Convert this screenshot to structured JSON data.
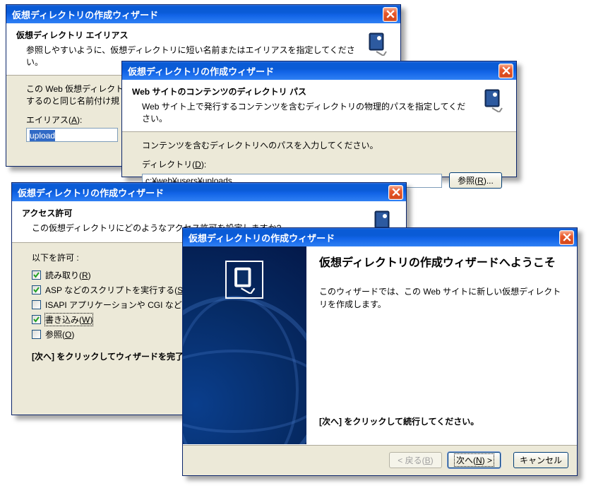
{
  "dialog1": {
    "title": "仮想ディレクトリの作成ウィザード",
    "band_title": "仮想ディレクトリ エイリアス",
    "band_desc": "参照しやすいように、仮想ディレクトリに短い名前またはエイリアスを指定してください。",
    "body_intro_line1": "この Web 仮想ディレクト",
    "body_intro_line2": "するのと同じ名前付け規",
    "alias_label_pre": "エイリアス(",
    "alias_key": "A",
    "alias_label_post": "):",
    "alias_value": "upload"
  },
  "dialog2": {
    "title": "仮想ディレクトリの作成ウィザード",
    "band_title": "Web サイトのコンテンツのディレクトリ パス",
    "band_desc": "Web サイト上で発行するコンテンツを含むディレクトリの物理的パスを指定してください。",
    "prompt": "コンテンツを含むディレクトリへのパスを入力してください。",
    "dir_label_pre": "ディレクトリ(",
    "dir_key": "D",
    "dir_label_post": "):",
    "dir_value": "c:¥web¥users¥uploads",
    "browse_label_pre": "参照(",
    "browse_key": "R",
    "browse_label_post": ")..."
  },
  "dialog3": {
    "title": "仮想ディレクトリの作成ウィザード",
    "band_title": "アクセス許可",
    "band_desc": "この仮想ディレクトリにどのようなアクセス許可を設定しますか?",
    "allow_label": "以下を許可 :",
    "perm_read_pre": "読み取り(",
    "perm_read_key": "R",
    "perm_read_post": ")",
    "perm_asp_pre": "ASP などのスクリプトを実行する(",
    "perm_asp_key": "S",
    "perm_asp_post": ")",
    "perm_isapi": "ISAPI アプリケーションや CGI などを実行",
    "perm_write_pre": "書き込み(",
    "perm_write_key": "W",
    "perm_write_post": ")",
    "perm_browse_pre": "参照(",
    "perm_browse_key": "O",
    "perm_browse_post": ")",
    "next_hint": "[次へ] をクリックしてウィザードを完了し"
  },
  "dialog4": {
    "title": "仮想ディレクトリの作成ウィザード",
    "welcome_title": "仮想ディレクトリの作成ウィザードへようこそ",
    "welcome_desc": "このウィザードでは、この Web サイトに新しい仮想ディレクトリを作成します。",
    "next_hint": "[次へ] をクリックして続行してください。",
    "btn_back_pre": "< 戻る(",
    "btn_back_key": "B",
    "btn_back_post": ")",
    "btn_next_pre": "次へ(",
    "btn_next_key": "N",
    "btn_next_post": ") >",
    "btn_cancel": "キャンセル"
  }
}
